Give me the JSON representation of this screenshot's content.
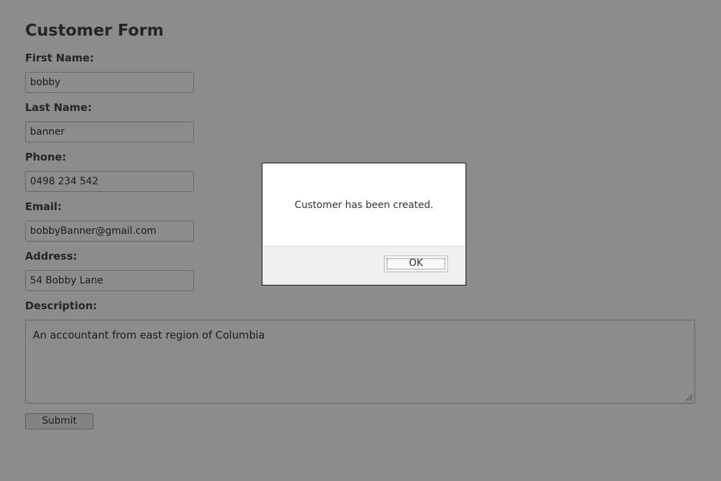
{
  "form": {
    "title": "Customer Form",
    "fields": {
      "first_name": {
        "label": "First Name:",
        "value": "bobby"
      },
      "last_name": {
        "label": "Last Name:",
        "value": "banner"
      },
      "phone": {
        "label": "Phone:",
        "value": "0498 234 542"
      },
      "email": {
        "label": "Email:",
        "value": "bobbyBanner@gmail.com"
      },
      "address": {
        "label": "Address:",
        "value": "54 Bobby Lane"
      },
      "description": {
        "label": "Description:",
        "value": "An accountant from east region of Columbia"
      }
    },
    "submit_label": "Submit"
  },
  "dialog": {
    "message": "Customer has been created.",
    "ok_label": "OK"
  },
  "colors": {
    "overlay": "#000000",
    "dialog_footer": "#f0f0f0"
  },
  "icons": {
    "resize_grip": "resize-grip-icon"
  }
}
